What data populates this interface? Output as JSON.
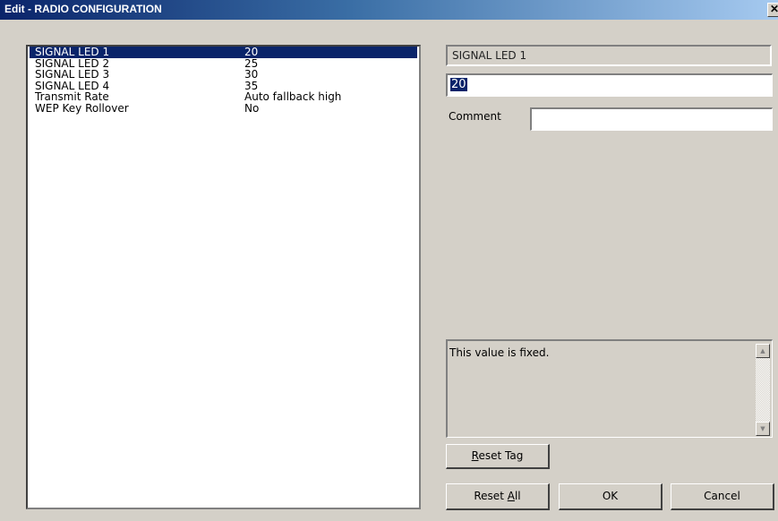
{
  "window": {
    "title": "Edit - RADIO CONFIGURATION",
    "close_glyph": "✕"
  },
  "list": {
    "items": [
      {
        "name": "SIGNAL LED 1",
        "value": "20",
        "selected": true
      },
      {
        "name": "SIGNAL LED 2",
        "value": "25"
      },
      {
        "name": "SIGNAL LED 3",
        "value": "30"
      },
      {
        "name": "SIGNAL LED 4",
        "value": "35"
      },
      {
        "name": "Transmit Rate",
        "value": "Auto fallback high"
      },
      {
        "name": "WEP Key Rollover",
        "value": "No"
      }
    ]
  },
  "detail": {
    "tag_name": "SIGNAL LED 1",
    "value": "20",
    "comment_label": "Comment",
    "comment_value": "",
    "info_text": "This value is fixed."
  },
  "buttons": {
    "reset_tag": {
      "mnemonic": "R",
      "rest": "eset Tag"
    },
    "reset_all": {
      "before": "Reset ",
      "mnemonic": "A",
      "after": "ll"
    },
    "ok": "OK",
    "cancel": "Cancel"
  },
  "icons": {
    "close": "close-icon",
    "scroll_up": "arrow-up-icon",
    "scroll_down": "arrow-down-icon"
  }
}
